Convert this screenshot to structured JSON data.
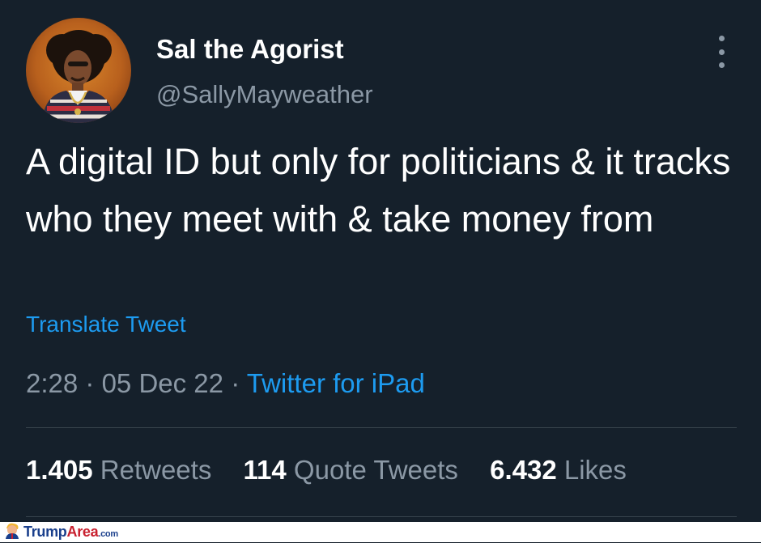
{
  "user": {
    "display_name": "Sal the Agorist",
    "handle": "@SallyMayweather"
  },
  "tweet": {
    "text": "A digital ID but only for politicians & it tracks who they meet with & take money from",
    "translate_label": "Translate Tweet",
    "time": "2:28",
    "separator": "·",
    "date": "05 Dec 22",
    "source": "Twitter for iPad"
  },
  "stats": [
    {
      "count": "1.405",
      "label": "Retweets"
    },
    {
      "count": "114",
      "label": "Quote Tweets"
    },
    {
      "count": "6.432",
      "label": "Likes"
    }
  ],
  "watermark": {
    "brand_part1": "Trump",
    "brand_part2": "Area",
    "suffix": ".com"
  },
  "colors": {
    "background": "#15202b",
    "primary_text": "#ffffff",
    "secondary_text": "#8b98a5",
    "link": "#1d9bf0",
    "divider": "#38444d"
  },
  "icons": [
    "more-options-icon",
    "watermark-logo-icon"
  ]
}
